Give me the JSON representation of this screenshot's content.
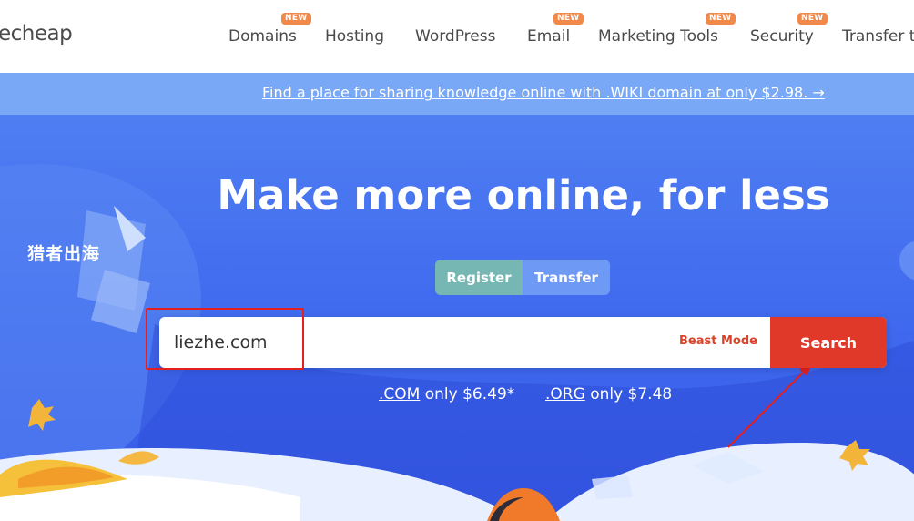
{
  "header": {
    "logo": "echeap",
    "nav": [
      {
        "label": "Domains",
        "badge": "NEW"
      },
      {
        "label": "Hosting",
        "badge": ""
      },
      {
        "label": "WordPress",
        "badge": ""
      },
      {
        "label": "Email",
        "badge": "NEW"
      },
      {
        "label": "Marketing Tools",
        "badge": "NEW"
      },
      {
        "label": "Security",
        "badge": "NEW"
      },
      {
        "label": "Transfer t",
        "badge": ""
      }
    ]
  },
  "promo": {
    "text": "Find a place for sharing knowledge online with .WIKI domain at only $2.98. →"
  },
  "hero": {
    "title": "Make more online, for less",
    "toggle": {
      "register": "Register",
      "transfer": "Transfer"
    },
    "search": {
      "value": "liezhe.com",
      "beast_mode": "Beast Mode",
      "button": "Search"
    },
    "prices": {
      "com_tld": ".COM",
      "com_text": "only $6.49*",
      "org_tld": ".ORG",
      "org_text": "only $7.48"
    },
    "watermark": "猎者出海"
  },
  "colors": {
    "accent": "#e0392a",
    "hero": "#3e68ee",
    "promo": "#79a8f7",
    "register": "#76b7b4",
    "badge": "#f0894a"
  }
}
